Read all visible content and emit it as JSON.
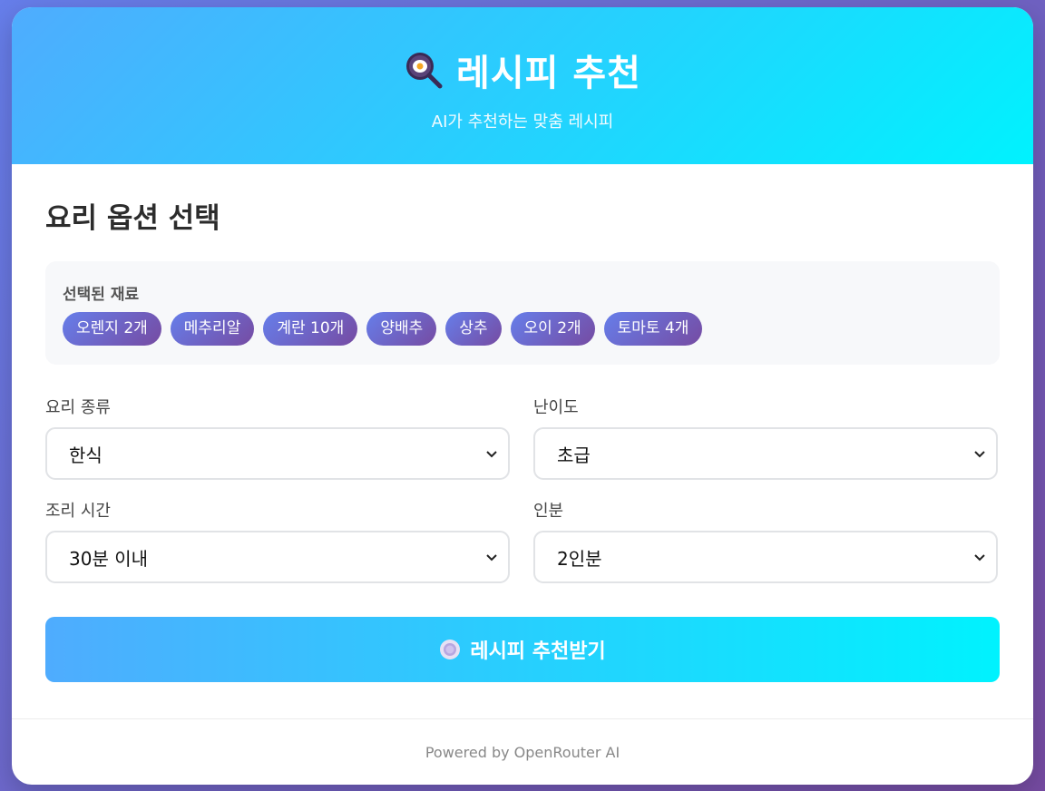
{
  "header": {
    "title": "레시피 추천",
    "subtitle": "AI가 추천하는 맞춤 레시피",
    "icon": "frying-pan-icon"
  },
  "options": {
    "section_title": "요리 옵션 선택",
    "ingredients_label": "선택된 재료",
    "ingredients": [
      "오렌지 2개",
      "메추리알",
      "계란 10개",
      "양배추",
      "상추",
      "오이 2개",
      "토마토 4개"
    ]
  },
  "form": {
    "cuisine": {
      "label": "요리 종류",
      "value": "한식"
    },
    "difficulty": {
      "label": "난이도",
      "value": "초급"
    },
    "time": {
      "label": "조리 시간",
      "value": "30분 이내"
    },
    "servings": {
      "label": "인분",
      "value": "2인분"
    }
  },
  "submit": {
    "label": "레시피 추천받기",
    "icon": "plate-icon"
  },
  "footer": {
    "text": "Powered by OpenRouter AI"
  },
  "colors": {
    "header_gradient": [
      "#4facfe",
      "#00f2fe"
    ],
    "chip_gradient": [
      "#667eea",
      "#764ba2"
    ],
    "background_gradient": [
      "#667eea",
      "#764ba2"
    ]
  }
}
